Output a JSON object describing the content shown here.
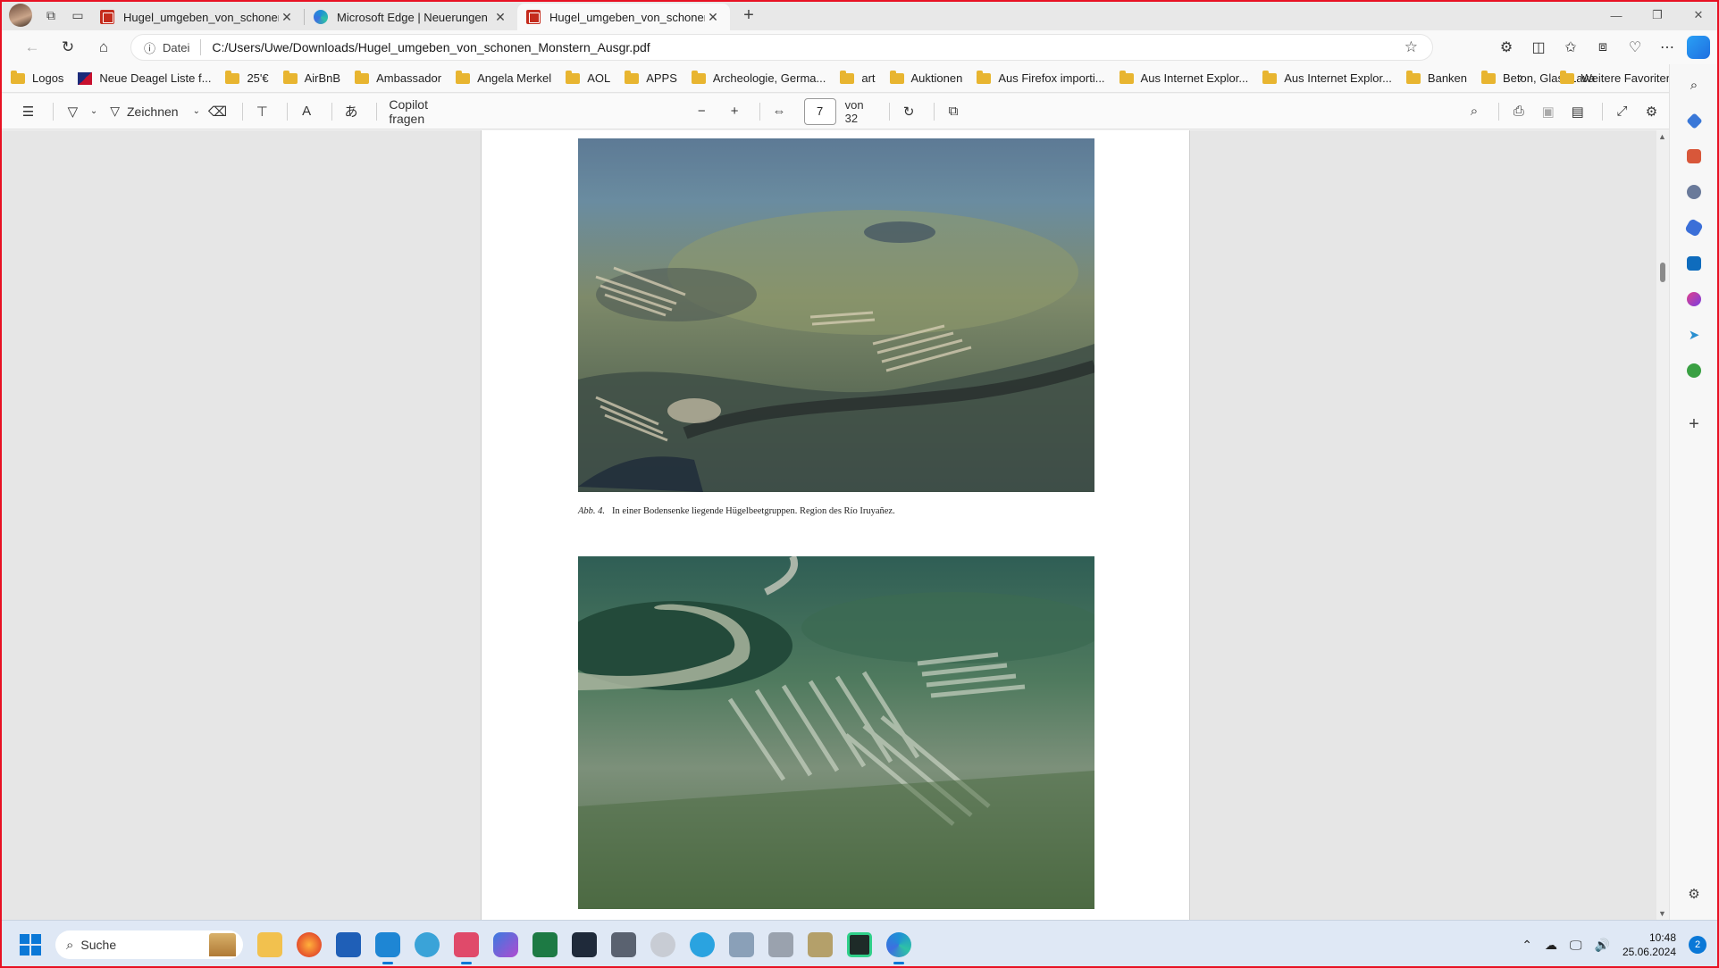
{
  "tabs": [
    {
      "title": "Hugel_umgeben_von_schonen_M",
      "favicon": "pdf-icon",
      "active": false
    },
    {
      "title": "Microsoft Edge | Neuerungen",
      "favicon": "edge-icon",
      "active": false
    },
    {
      "title": "Hugel_umgeben_von_schonen_M",
      "favicon": "pdf-icon",
      "active": true
    }
  ],
  "address": {
    "scheme_label": "Datei",
    "url": "C:/Users/Uwe/Downloads/Hugel_umgeben_von_schonen_Monstern_Ausgr.pdf"
  },
  "bookmarks": [
    "Logos",
    "Neue Deagel Liste f...",
    "25'€",
    "AirBnB",
    "Ambassador",
    "Angela Merkel",
    "AOL",
    "APPS",
    "Archeologie, Germa...",
    "art",
    "Auktionen",
    "Aus Firefox importi...",
    "Aus Internet Explor...",
    "Aus Internet Explor...",
    "Banken",
    "Beton, Glas, Lava"
  ],
  "bookmarks_more": "Weitere Favoriten",
  "pdf_toolbar": {
    "draw_label": "Zeichnen",
    "copilot_label": "Copilot fragen",
    "page_current": "7",
    "page_total_label": "von 32"
  },
  "document": {
    "caption_label": "Abb. 4.",
    "caption_text": "In einer Bodensenke liegende Hügelbeetgruppen. Region des Río Iruyañez."
  },
  "taskbar": {
    "search_placeholder": "Suche",
    "time": "10:48",
    "date": "25.06.2024",
    "notification_count": "2"
  },
  "colors": {
    "accent": "#0a78d7",
    "frame_border": "#e81123",
    "pdf_red": "#c42b1c",
    "folder": "#e8b530"
  }
}
